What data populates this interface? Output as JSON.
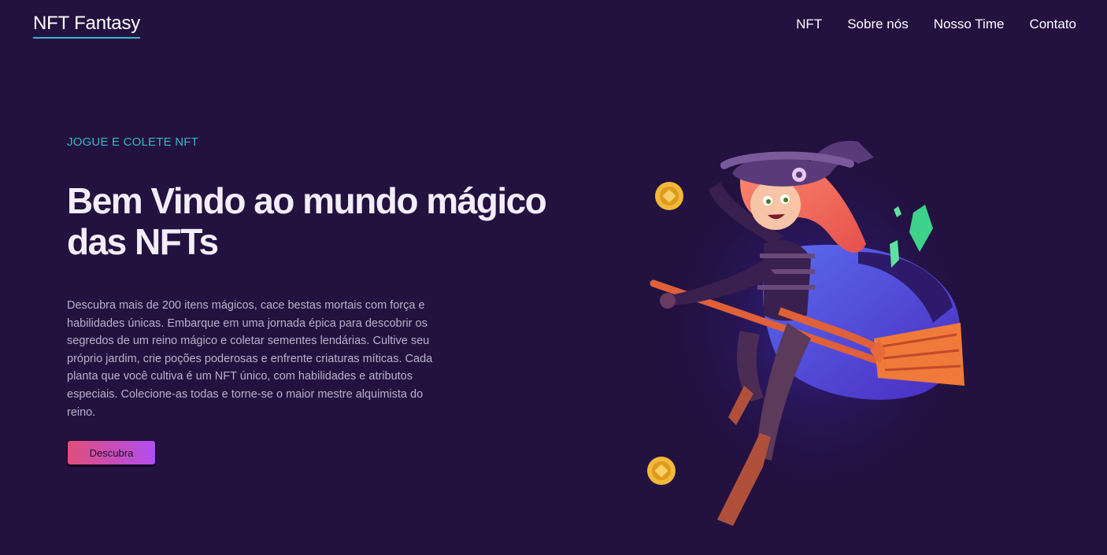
{
  "brand": "NFT Fantasy",
  "nav": [
    "NFT",
    "Sobre nós",
    "Nosso Time",
    "Contato"
  ],
  "hero": {
    "eyebrow": "JOGUE E COLETE NFT",
    "headline_line1": "Bem Vindo ao mundo mágico",
    "headline_line2": "das NFTs",
    "description": "Descubra mais de 200 itens mágicos, cace bestas mortais com força e habilidades únicas. Embarque em uma jornada épica para descobrir os segredos de um reino mágico e coletar sementes lendárias. Cultive seu próprio jardim, crie poções poderosas e enfrente criaturas míticas. Cada planta que você cultiva é um NFT único, com habilidades e atributos especiais. Colecione-as todas e torne-se o maior mestre alquimista do reino.",
    "cta_label": "Descubra"
  },
  "illustration": {
    "subject": "witch-on-broom-illustration",
    "coins": 2,
    "crystals": 2
  },
  "colors": {
    "background": "#231140",
    "accent": "#36b8c4",
    "button_from": "#e04f7a",
    "button_to": "#b14ef0"
  }
}
